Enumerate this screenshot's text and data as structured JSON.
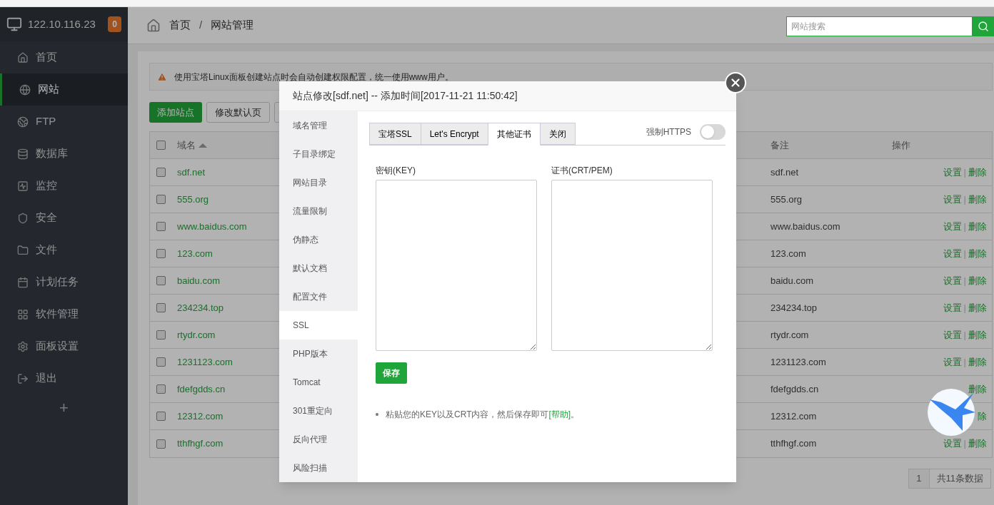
{
  "sidebar": {
    "host": "122.10.116.23",
    "badge": "0",
    "items": [
      {
        "label": "首页",
        "selected": false
      },
      {
        "label": "网站",
        "selected": true
      },
      {
        "label": "FTP",
        "selected": false
      },
      {
        "label": "数据库",
        "selected": false
      },
      {
        "label": "监控",
        "selected": false
      },
      {
        "label": "安全",
        "selected": false
      },
      {
        "label": "文件",
        "selected": false
      },
      {
        "label": "计划任务",
        "selected": false
      },
      {
        "label": "软件管理",
        "selected": false
      },
      {
        "label": "面板设置",
        "selected": false
      },
      {
        "label": "退出",
        "selected": false
      }
    ],
    "add": "+"
  },
  "header": {
    "breadcrumb": [
      "首页",
      "网站管理"
    ],
    "separator": "/",
    "search": {
      "placeholder": "网站搜索"
    }
  },
  "alert": "使用宝塔Linux面板创建站点时会自动创建权限配置，统一使用www用户。",
  "buttons": [
    "添加站点",
    "修改默认页"
  ],
  "table": {
    "select_all_checked": false,
    "columns": {
      "domain": "域名",
      "note": "备注",
      "actions": "操作"
    },
    "separator": "|",
    "rows": [
      {
        "domain": "sdf.net",
        "note": "sdf.net",
        "checked": false,
        "actions": [
          "设置",
          "删除"
        ]
      },
      {
        "domain": "555.org",
        "note": "555.org",
        "checked": false,
        "actions": [
          "设置",
          "删除"
        ]
      },
      {
        "domain": "www.baidus.com",
        "note": "www.baidus.com",
        "checked": false,
        "actions": [
          "设置",
          "删除"
        ]
      },
      {
        "domain": "123.com",
        "note": "123.com",
        "checked": false,
        "actions": [
          "设置",
          "删除"
        ]
      },
      {
        "domain": "baidu.com",
        "note": "baidu.com",
        "checked": false,
        "actions": [
          "设置",
          "删除"
        ]
      },
      {
        "domain": "234234.top",
        "note": "234234.top",
        "checked": false,
        "actions": [
          "设置",
          "删除"
        ]
      },
      {
        "domain": "rtydr.com",
        "note": "rtydr.com",
        "checked": false,
        "actions": [
          "设置",
          "删除"
        ]
      },
      {
        "domain": "1231123.com",
        "note": "1231123.com",
        "checked": false,
        "actions": [
          "设置",
          "删除"
        ]
      },
      {
        "domain": "fdefgdds.cn",
        "note": "fdefgdds.cn",
        "checked": false,
        "actions": [
          "删除"
        ]
      },
      {
        "domain": "12312.com",
        "note": "12312.com",
        "checked": false,
        "actions": [
          "除"
        ]
      },
      {
        "domain": "tthfhgf.com",
        "note": "tthfhgf.com",
        "checked": false,
        "actions": [
          "设置",
          "删除"
        ]
      }
    ]
  },
  "pagination": {
    "page": "1",
    "total": "共11条数据"
  },
  "modal": {
    "title": "站点修改[sdf.net] -- 添加时间[2017-11-21 11:50:42]",
    "nav": [
      {
        "label": "域名管理",
        "selected": false
      },
      {
        "label": "子目录绑定",
        "selected": false
      },
      {
        "label": "网站目录",
        "selected": false
      },
      {
        "label": "流量限制",
        "selected": false
      },
      {
        "label": "伪静态",
        "selected": false
      },
      {
        "label": "默认文档",
        "selected": false
      },
      {
        "label": "配置文件",
        "selected": false
      },
      {
        "label": "SSL",
        "selected": true
      },
      {
        "label": "PHP版本",
        "selected": false
      },
      {
        "label": "Tomcat",
        "selected": false
      },
      {
        "label": "301重定向",
        "selected": false
      },
      {
        "label": "反向代理",
        "selected": false
      },
      {
        "label": "风险扫描",
        "selected": false
      }
    ],
    "tabs": [
      {
        "label": "宝塔SSL",
        "selected": false
      },
      {
        "label": "Let's Encrypt",
        "selected": false
      },
      {
        "label": "其他证书",
        "selected": true
      },
      {
        "label": "关闭",
        "selected": false
      }
    ],
    "force_https": {
      "label": "强制HTTPS",
      "on": false
    },
    "fields": [
      {
        "label": "密钥(KEY)"
      },
      {
        "label": "证书(CRT/PEM)"
      }
    ],
    "save": "保存",
    "note": {
      "text": "粘贴您的KEY以及CRT内容，然后保存即可",
      "link": "[帮助]",
      "end": "。"
    }
  }
}
